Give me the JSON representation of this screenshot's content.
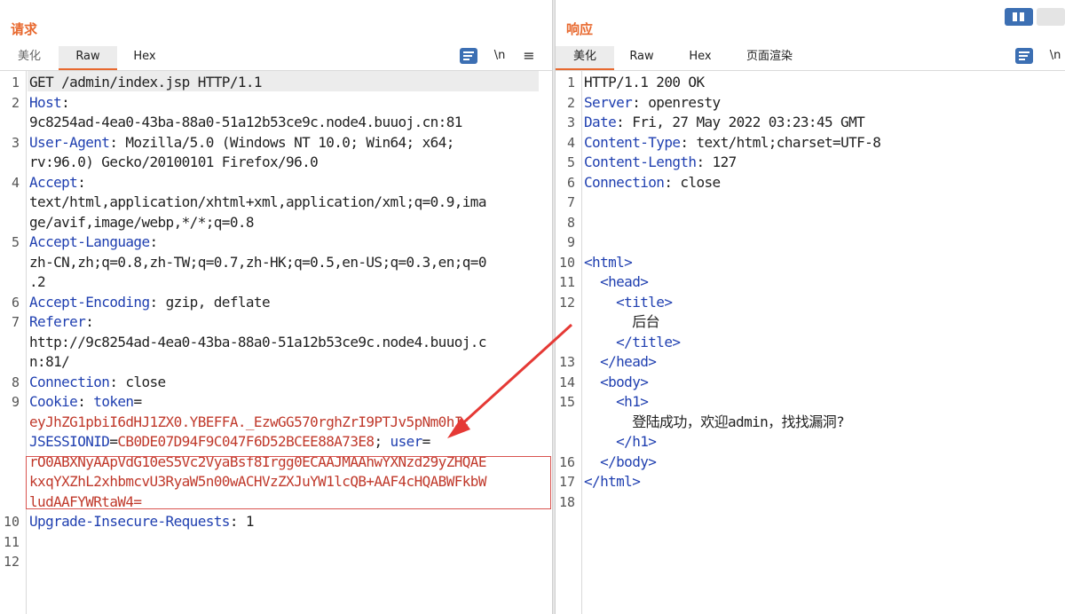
{
  "request": {
    "title": "请求",
    "tabs": [
      "美化",
      "Raw",
      "Hex"
    ],
    "newline_label": "\\n",
    "menu_label": "≡",
    "lines": [
      {
        "n": "1",
        "segs": [
          [
            "v",
            "GET /admin/index.jsp HTTP/1.1"
          ]
        ]
      },
      {
        "n": "2",
        "segs": [
          [
            "k",
            "Host"
          ],
          [
            "v",
            ":"
          ]
        ]
      },
      {
        "n": "",
        "segs": [
          [
            "v",
            "9c8254ad-4ea0-43ba-88a0-51a12b53ce9c.node4.buuoj.cn:81"
          ]
        ]
      },
      {
        "n": "3",
        "segs": [
          [
            "k",
            "User-Agent"
          ],
          [
            "v",
            ": Mozilla/5.0 (Windows NT 10.0; Win64; x64;"
          ]
        ]
      },
      {
        "n": "",
        "segs": [
          [
            "v",
            "rv:96.0) Gecko/20100101 Firefox/96.0"
          ]
        ]
      },
      {
        "n": "4",
        "segs": [
          [
            "k",
            "Accept"
          ],
          [
            "v",
            ":"
          ]
        ]
      },
      {
        "n": "",
        "segs": [
          [
            "v",
            "text/html,application/xhtml+xml,application/xml;q=0.9,ima"
          ]
        ]
      },
      {
        "n": "",
        "segs": [
          [
            "v",
            "ge/avif,image/webp,*/*;q=0.8"
          ]
        ]
      },
      {
        "n": "5",
        "segs": [
          [
            "k",
            "Accept-Language"
          ],
          [
            "v",
            ":"
          ]
        ]
      },
      {
        "n": "",
        "segs": [
          [
            "v",
            "zh-CN,zh;q=0.8,zh-TW;q=0.7,zh-HK;q=0.5,en-US;q=0.3,en;q=0"
          ]
        ]
      },
      {
        "n": "",
        "segs": [
          [
            "v",
            ".2"
          ]
        ]
      },
      {
        "n": "6",
        "segs": [
          [
            "k",
            "Accept-Encoding"
          ],
          [
            "v",
            ": gzip, deflate"
          ]
        ]
      },
      {
        "n": "7",
        "segs": [
          [
            "k",
            "Referer"
          ],
          [
            "v",
            ":"
          ]
        ]
      },
      {
        "n": "",
        "segs": [
          [
            "v",
            "http://9c8254ad-4ea0-43ba-88a0-51a12b53ce9c.node4.buuoj.c"
          ]
        ]
      },
      {
        "n": "",
        "segs": [
          [
            "v",
            "n:81/"
          ]
        ]
      },
      {
        "n": "8",
        "segs": [
          [
            "k",
            "Connection"
          ],
          [
            "v",
            ": close"
          ]
        ]
      },
      {
        "n": "9",
        "segs": [
          [
            "k",
            "Cookie"
          ],
          [
            "v",
            ": "
          ],
          [
            "k",
            "token"
          ],
          [
            "v",
            "="
          ]
        ]
      },
      {
        "n": "",
        "segs": [
          [
            "ck",
            "eyJhZG1pbiI6dHJ1ZX0.YBEFFA._EzwGG570rghZrI9PTJv5pNm0hI"
          ],
          [
            "v",
            "; "
          ]
        ]
      },
      {
        "n": "",
        "segs": [
          [
            "k",
            "JSESSIONID"
          ],
          [
            "v",
            "="
          ],
          [
            "ck",
            "CB0DE07D94F9C047F6D52BCEE88A73E8"
          ],
          [
            "v",
            "; "
          ],
          [
            "k",
            "user"
          ],
          [
            "v",
            "="
          ]
        ]
      },
      {
        "n": "",
        "segs": [
          [
            "ck",
            "rO0ABXNyAApVdG10eS5Vc2VyaBsf8Irgg0ECAAJMAAhwYXNzd29yZHQAE"
          ]
        ]
      },
      {
        "n": "",
        "segs": [
          [
            "ck",
            "kxqYXZhL2xhbmcvU3RyaW5n00wACHVzZXJuYW1lcQB+AAF4cHQABWFkbW"
          ]
        ]
      },
      {
        "n": "",
        "segs": [
          [
            "ck",
            "ludAAFYWRtaW4="
          ]
        ]
      },
      {
        "n": "10",
        "segs": [
          [
            "k",
            "Upgrade-Insecure-Requests"
          ],
          [
            "v",
            ": 1"
          ]
        ]
      },
      {
        "n": "11",
        "segs": []
      },
      {
        "n": "12",
        "segs": []
      }
    ]
  },
  "response": {
    "title": "响应",
    "tabs": [
      "美化",
      "Raw",
      "Hex",
      "页面渲染"
    ],
    "newline_label": "\\n",
    "lines": [
      {
        "n": "1",
        "segs": [
          [
            "v",
            "HTTP/1.1 200 OK"
          ]
        ]
      },
      {
        "n": "2",
        "segs": [
          [
            "k",
            "Server"
          ],
          [
            "v",
            ": openresty"
          ]
        ]
      },
      {
        "n": "3",
        "segs": [
          [
            "k",
            "Date"
          ],
          [
            "v",
            ": Fri, 27 May 2022 03:23:45 GMT"
          ]
        ]
      },
      {
        "n": "4",
        "segs": [
          [
            "k",
            "Content-Type"
          ],
          [
            "v",
            ": text/html;charset=UTF-8"
          ]
        ]
      },
      {
        "n": "5",
        "segs": [
          [
            "k",
            "Content-Length"
          ],
          [
            "v",
            ": 127"
          ]
        ]
      },
      {
        "n": "6",
        "segs": [
          [
            "k",
            "Connection"
          ],
          [
            "v",
            ": close"
          ]
        ]
      },
      {
        "n": "7",
        "segs": []
      },
      {
        "n": "8",
        "segs": []
      },
      {
        "n": "9",
        "segs": []
      },
      {
        "n": "10",
        "segs": [
          [
            "tag",
            "<html>"
          ]
        ]
      },
      {
        "n": "11",
        "segs": [
          [
            "v",
            "  "
          ],
          [
            "tag",
            "<head>"
          ]
        ]
      },
      {
        "n": "12",
        "segs": [
          [
            "v",
            "    "
          ],
          [
            "tag",
            "<title>"
          ]
        ]
      },
      {
        "n": "",
        "segs": [
          [
            "v",
            "      后台"
          ]
        ]
      },
      {
        "n": "",
        "segs": [
          [
            "v",
            "    "
          ],
          [
            "tag",
            "</title>"
          ]
        ]
      },
      {
        "n": "13",
        "segs": [
          [
            "v",
            "  "
          ],
          [
            "tag",
            "</head>"
          ]
        ]
      },
      {
        "n": "14",
        "segs": [
          [
            "v",
            "  "
          ],
          [
            "tag",
            "<body>"
          ]
        ]
      },
      {
        "n": "15",
        "segs": [
          [
            "v",
            "    "
          ],
          [
            "tag",
            "<h1>"
          ]
        ]
      },
      {
        "n": "",
        "segs": [
          [
            "v",
            "      登陆成功，欢迎admin，找找漏洞?"
          ]
        ]
      },
      {
        "n": "",
        "segs": [
          [
            "v",
            "    "
          ],
          [
            "tag",
            "</h1>"
          ]
        ]
      },
      {
        "n": "16",
        "segs": [
          [
            "v",
            "  "
          ],
          [
            "tag",
            "</body>"
          ]
        ]
      },
      {
        "n": "17",
        "segs": [
          [
            "tag",
            "</html>"
          ]
        ]
      },
      {
        "n": "18",
        "segs": []
      }
    ]
  },
  "colors": {
    "accent": "#e8692f",
    "header_key": "#1f3fb0",
    "cookie_value": "#c0392b",
    "annotation": "#e53935",
    "toolbar_blue": "#3c6fb3"
  },
  "icons": {
    "wrap": "word-wrap-icon",
    "menu": "hamburger-menu-icon",
    "layout": "layout-toggle-icon"
  }
}
